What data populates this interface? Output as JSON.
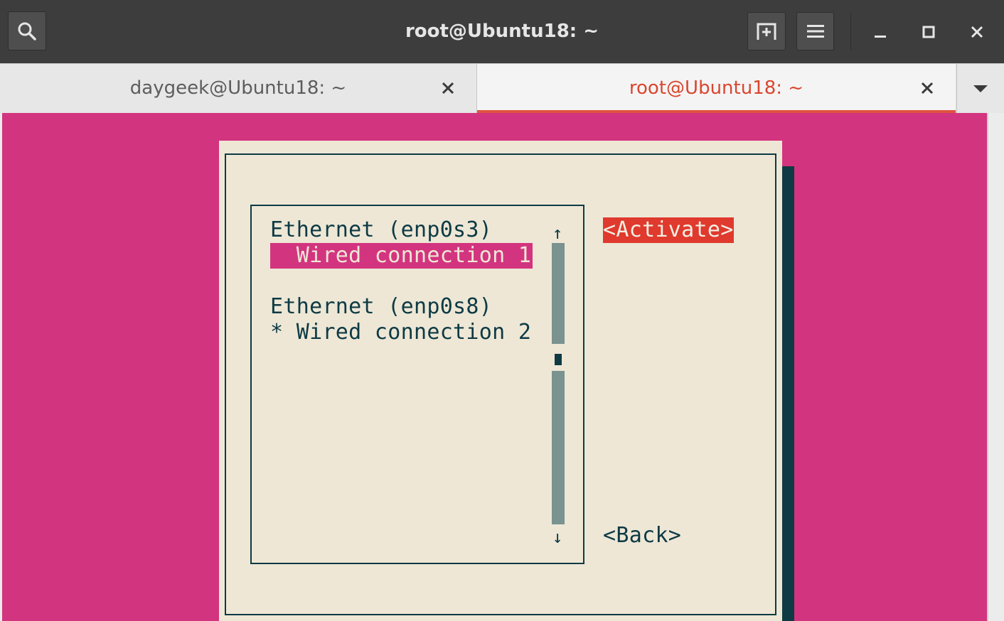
{
  "window": {
    "title": "root@Ubuntu18: ~"
  },
  "tabs": [
    {
      "label": "daygeek@Ubuntu18: ~",
      "active": false
    },
    {
      "label": "root@Ubuntu18: ~",
      "active": true
    }
  ],
  "icons": {
    "search": "search-icon",
    "new_tab": "new-tab-icon",
    "menu": "hamburger-menu-icon",
    "minimize": "minimize-icon",
    "maximize": "maximize-icon",
    "close": "close-icon",
    "tab_close": "close-icon",
    "tab_dropdown": "chevron-down-icon"
  },
  "colors": {
    "terminal_bg": "#d3347f",
    "dialog_bg": "#eee7d6",
    "dialog_fg": "#0d3a44",
    "active_tab": "#e0533f",
    "activate_button": "#e0392d"
  },
  "nmtui": {
    "devices": [
      {
        "label": "Ethernet (enp0s3)",
        "connection": "  Wired connection 1",
        "selected": true
      },
      {
        "label": "Ethernet (enp0s8)",
        "connection": "* Wired connection 2",
        "selected": false
      }
    ],
    "scroll_up": "↑",
    "scroll_down": "↓",
    "activate_label": "<Activate>",
    "back_label": "<Back>"
  }
}
